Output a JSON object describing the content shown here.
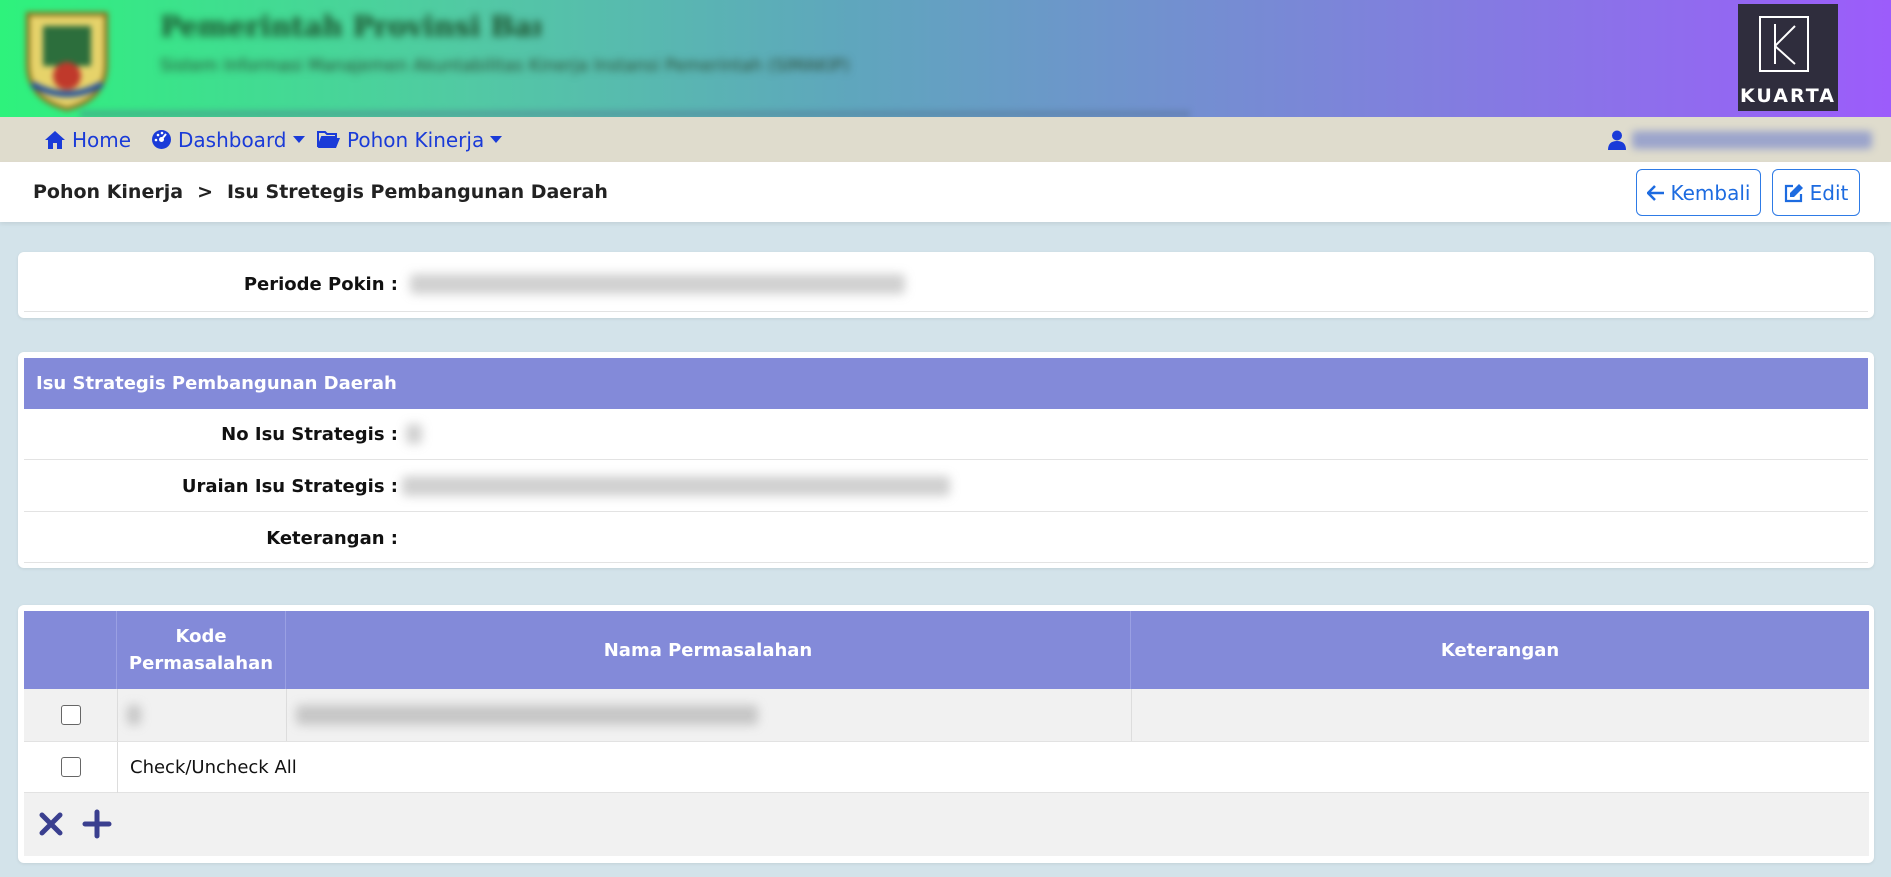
{
  "banner": {
    "title": "Pemerintah Provinsi Banten",
    "subtitle": "Sistem Informasi Manajemen Akuntabilitas Kinerja Instansi Pemerintah (SIMAKIP)",
    "brand": "KUARTA"
  },
  "nav": {
    "home": "Home",
    "dashboard": "Dashboard",
    "pohon_kinerja": "Pohon Kinerja",
    "user": "Administrator"
  },
  "breadcrumb": {
    "parent": "Pohon Kinerja",
    "separator": ">",
    "current": "Isu Stretegis Pembangunan Daerah",
    "back_label": "Kembali",
    "edit_label": "Edit"
  },
  "periode": {
    "label": "Periode Pokin :",
    "value": "2025-2029 Pohon Kinerja Prov. Banten 2025-2029"
  },
  "isu": {
    "heading": "Isu Strategis Pembangunan Daerah",
    "no_label": "No Isu Strategis :",
    "no_value": "1",
    "uraian_label": "Uraian Isu Strategis :",
    "uraian_value": "Penerapan reformasi birokrasi yang bersih dan transparan",
    "keterangan_label": "Keterangan :",
    "keterangan_value": ""
  },
  "table": {
    "headers": {
      "kode": "Kode Permasalahan",
      "nama": "Nama Permasalahan",
      "keterangan": "Keterangan"
    },
    "rows": [
      {
        "kode": "1",
        "nama": "Rendahnya penerapan birokrasi yang bersih dan akuntabel",
        "keterangan": ""
      }
    ],
    "check_all_label": "Check/Uncheck All"
  },
  "colors": {
    "accent": "#838ad9",
    "link": "#1a3bd8",
    "nav_bg": "#dfdccd",
    "page_bg": "#d3e3ea"
  }
}
